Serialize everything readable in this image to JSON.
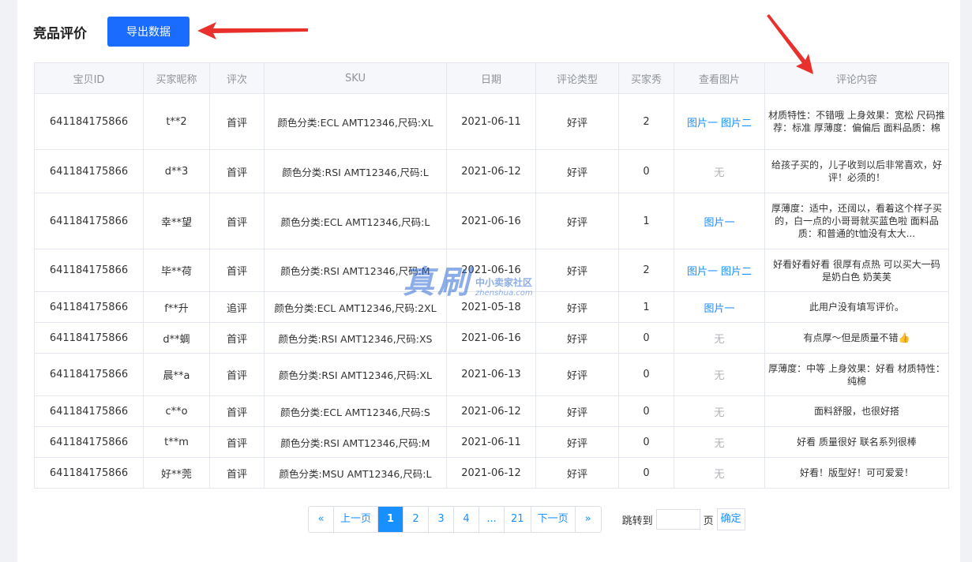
{
  "header": {
    "title": "竞品评价",
    "export_label": "导出数据"
  },
  "table": {
    "columns": [
      "宝贝ID",
      "买家昵称",
      "评次",
      "SKU",
      "日期",
      "评论类型",
      "买家秀",
      "查看图片",
      "评论内容"
    ],
    "rows": [
      {
        "id": "641184175866",
        "nick": "t**2",
        "times": "首评",
        "sku": "颜色分类:ECL AMT12346,尺码:XL",
        "date": "2021-06-11",
        "type": "好评",
        "show": "2",
        "images": [
          "图片一",
          "图片二"
        ],
        "no_image": "",
        "comment": "材质特性：不错哦 上身效果：宽松 尺码推荐：标准 厚薄度：偏偏后 面料品质：棉"
      },
      {
        "id": "641184175866",
        "nick": "d**3",
        "times": "首评",
        "sku": "颜色分类:RSI AMT12346,尺码:L",
        "date": "2021-06-12",
        "type": "好评",
        "show": "0",
        "images": [],
        "no_image": "无",
        "comment": "给孩子买的，儿子收到以后非常喜欢，好评！必须的！"
      },
      {
        "id": "641184175866",
        "nick": "幸**望",
        "times": "首评",
        "sku": "颜色分类:ECL AMT12346,尺码:L",
        "date": "2021-06-16",
        "type": "好评",
        "show": "1",
        "images": [
          "图片一"
        ],
        "no_image": "",
        "comment": "厚薄度：适中，还阔以，看着这个样子买的，白一点的小哥哥就买蓝色啦 面料品质：和普通的t恤没有太大..."
      },
      {
        "id": "641184175866",
        "nick": "毕**荷",
        "times": "首评",
        "sku": "颜色分类:RSI AMT12346,尺码:M",
        "date": "2021-06-16",
        "type": "好评",
        "show": "2",
        "images": [
          "图片一",
          "图片二"
        ],
        "no_image": "",
        "comment": "好看好看好看 很厚有点热 可以买大一码 是奶白色 奶芙芙"
      },
      {
        "id": "641184175866",
        "nick": "f**升",
        "times": "追评",
        "sku": "颜色分类:ECL AMT12346,尺码:2XL",
        "date": "2021-05-18",
        "type": "好评",
        "show": "1",
        "images": [
          "图片一"
        ],
        "no_image": "",
        "comment": "此用户没有填写评价。"
      },
      {
        "id": "641184175866",
        "nick": "d**蜩",
        "times": "首评",
        "sku": "颜色分类:RSI AMT12346,尺码:XS",
        "date": "2021-06-16",
        "type": "好评",
        "show": "0",
        "images": [],
        "no_image": "无",
        "comment": "有点厚～但是质量不错👍"
      },
      {
        "id": "641184175866",
        "nick": "晨**a",
        "times": "首评",
        "sku": "颜色分类:RSI AMT12346,尺码:XL",
        "date": "2021-06-13",
        "type": "好评",
        "show": "0",
        "images": [],
        "no_image": "无",
        "comment": "厚薄度：中等 上身效果：好看 材质特性：纯棉"
      },
      {
        "id": "641184175866",
        "nick": "c**o",
        "times": "首评",
        "sku": "颜色分类:ECL AMT12346,尺码:S",
        "date": "2021-06-12",
        "type": "好评",
        "show": "0",
        "images": [],
        "no_image": "无",
        "comment": "面料舒服，也很好搭"
      },
      {
        "id": "641184175866",
        "nick": "t**m",
        "times": "首评",
        "sku": "颜色分类:RSI AMT12346,尺码:M",
        "date": "2021-06-11",
        "type": "好评",
        "show": "0",
        "images": [],
        "no_image": "无",
        "comment": "好看 质量很好 联名系列很棒"
      },
      {
        "id": "641184175866",
        "nick": "好**莞",
        "times": "首评",
        "sku": "颜色分类:MSU AMT12346,尺码:L",
        "date": "2021-06-12",
        "type": "好评",
        "show": "0",
        "images": [],
        "no_image": "无",
        "comment": "好看！版型好！可可爱爱！"
      }
    ]
  },
  "pagination": {
    "first": "«",
    "prev": "上一页",
    "pages": [
      "1",
      "2",
      "3",
      "4",
      "...",
      "21"
    ],
    "current": "1",
    "next": "下一页",
    "last": "»",
    "jump_label": "跳转到",
    "page_suffix": "页",
    "confirm_label": "确定"
  },
  "watermark": {
    "big": "真刷",
    "small": "中小卖家社区",
    "url": "zhenshua.com"
  },
  "colors": {
    "primary": "#1a6cff",
    "link": "#1890ff",
    "arrow": "#e8302d"
  }
}
